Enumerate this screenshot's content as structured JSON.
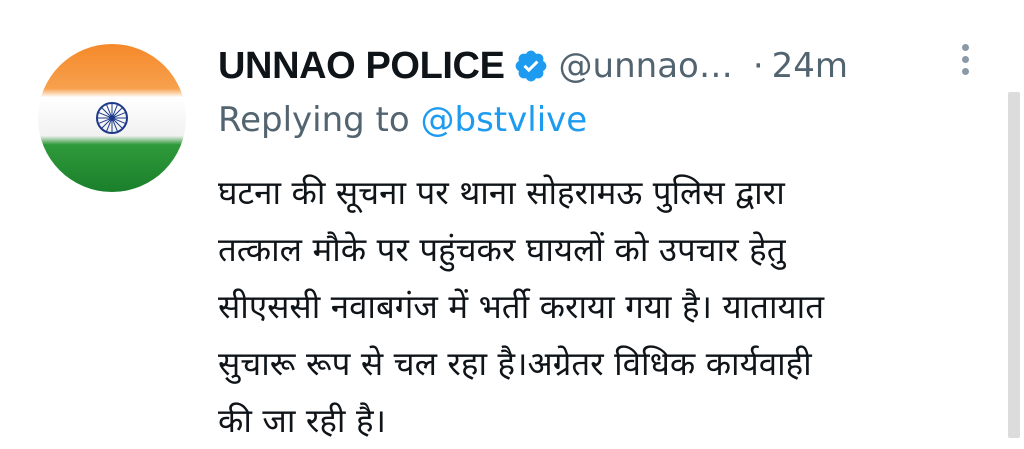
{
  "tweet": {
    "author_name": "UNNAO POLICE",
    "handle": "@unnao…",
    "separator": "·",
    "time": "24m",
    "replying_prefix": "Replying to",
    "replying_to": "@bstvlive",
    "text_lines": [
      "घटना की सूचना पर थाना सोहरामऊ पुलिस द्वारा",
      "तत्काल मौके पर पहुंचकर घायलों को उपचार हेतु",
      "सीएससी नवाबगंज में भर्ती कराया गया है। यातायात",
      "सुचारू रूप से चल रहा है।अग्रेतर विधिक कार्यवाही",
      "की जा रही है।"
    ]
  },
  "icons": {
    "verified": "verified-badge-icon",
    "more": "more-vertical-icon",
    "avatar_wheel": "ashoka-chakra-icon"
  },
  "colors": {
    "name": "#0f1419",
    "secondary": "#536471",
    "link": "#1d9bf0",
    "verified": "#1d9bf0",
    "saffron": "#f5892a",
    "green": "#1a7f2b",
    "chakra": "#1d3a8a"
  }
}
